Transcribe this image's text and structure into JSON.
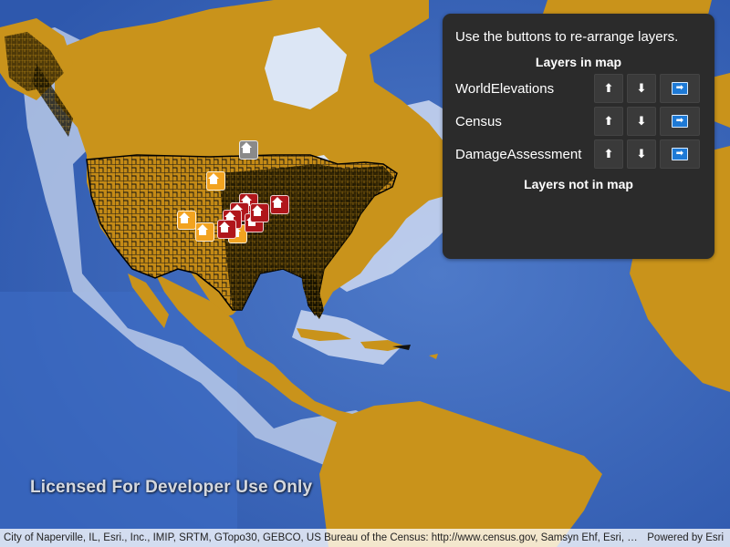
{
  "map": {
    "watermark": "Licensed For Developer Use Only",
    "attribution": "City of Naperville, IL, Esri., Inc., IMIP, SRTM, GTopo30, GEBCO, US Bureau of the Census: http://www.census.gov, Samsyn Ehf, Esri, F...",
    "powered_by": "Powered by Esri",
    "colors": {
      "ocean": "#3a63b8",
      "ocean_shallow": "#c8d6ee",
      "land": "#c9931b",
      "county_lines": "#111111",
      "marker_orange": "#f2a320",
      "marker_red": "#b0161b",
      "marker_gray": "#8a8a8a"
    },
    "markers": [
      {
        "color": "gray",
        "icon": "house-icon"
      },
      {
        "color": "orange",
        "icon": "house-icon"
      },
      {
        "color": "orange",
        "icon": "house-icon"
      },
      {
        "color": "orange",
        "icon": "house-icon"
      },
      {
        "color": "orange",
        "icon": "house-icon"
      },
      {
        "color": "red",
        "icon": "house-icon"
      },
      {
        "color": "red",
        "icon": "house-icon"
      },
      {
        "color": "red",
        "icon": "house-icon"
      },
      {
        "color": "red",
        "icon": "house-icon"
      },
      {
        "color": "red",
        "icon": "house-icon"
      },
      {
        "color": "red",
        "icon": "house-icon"
      },
      {
        "color": "red",
        "icon": "house-icon"
      }
    ]
  },
  "panel": {
    "instructions": "Use the buttons to re-arrange layers.",
    "in_map_heading": "Layers in map",
    "not_in_map_heading": "Layers not in map",
    "layers_in_map": [
      {
        "name": "WorldElevations",
        "up_icon": "arrow-up-icon",
        "down_icon": "arrow-down-icon",
        "remove_icon": "arrow-right-icon",
        "up_label": "⬆",
        "down_label": "⬇",
        "remove_label": "➡"
      },
      {
        "name": "Census",
        "up_icon": "arrow-up-icon",
        "down_icon": "arrow-down-icon",
        "remove_icon": "arrow-right-icon",
        "up_label": "⬆",
        "down_label": "⬇",
        "remove_label": "➡"
      },
      {
        "name": "DamageAssessment",
        "up_icon": "arrow-up-icon",
        "down_icon": "arrow-down-icon",
        "remove_icon": "arrow-right-icon",
        "up_label": "⬆",
        "down_label": "⬇",
        "remove_label": "➡"
      }
    ]
  }
}
